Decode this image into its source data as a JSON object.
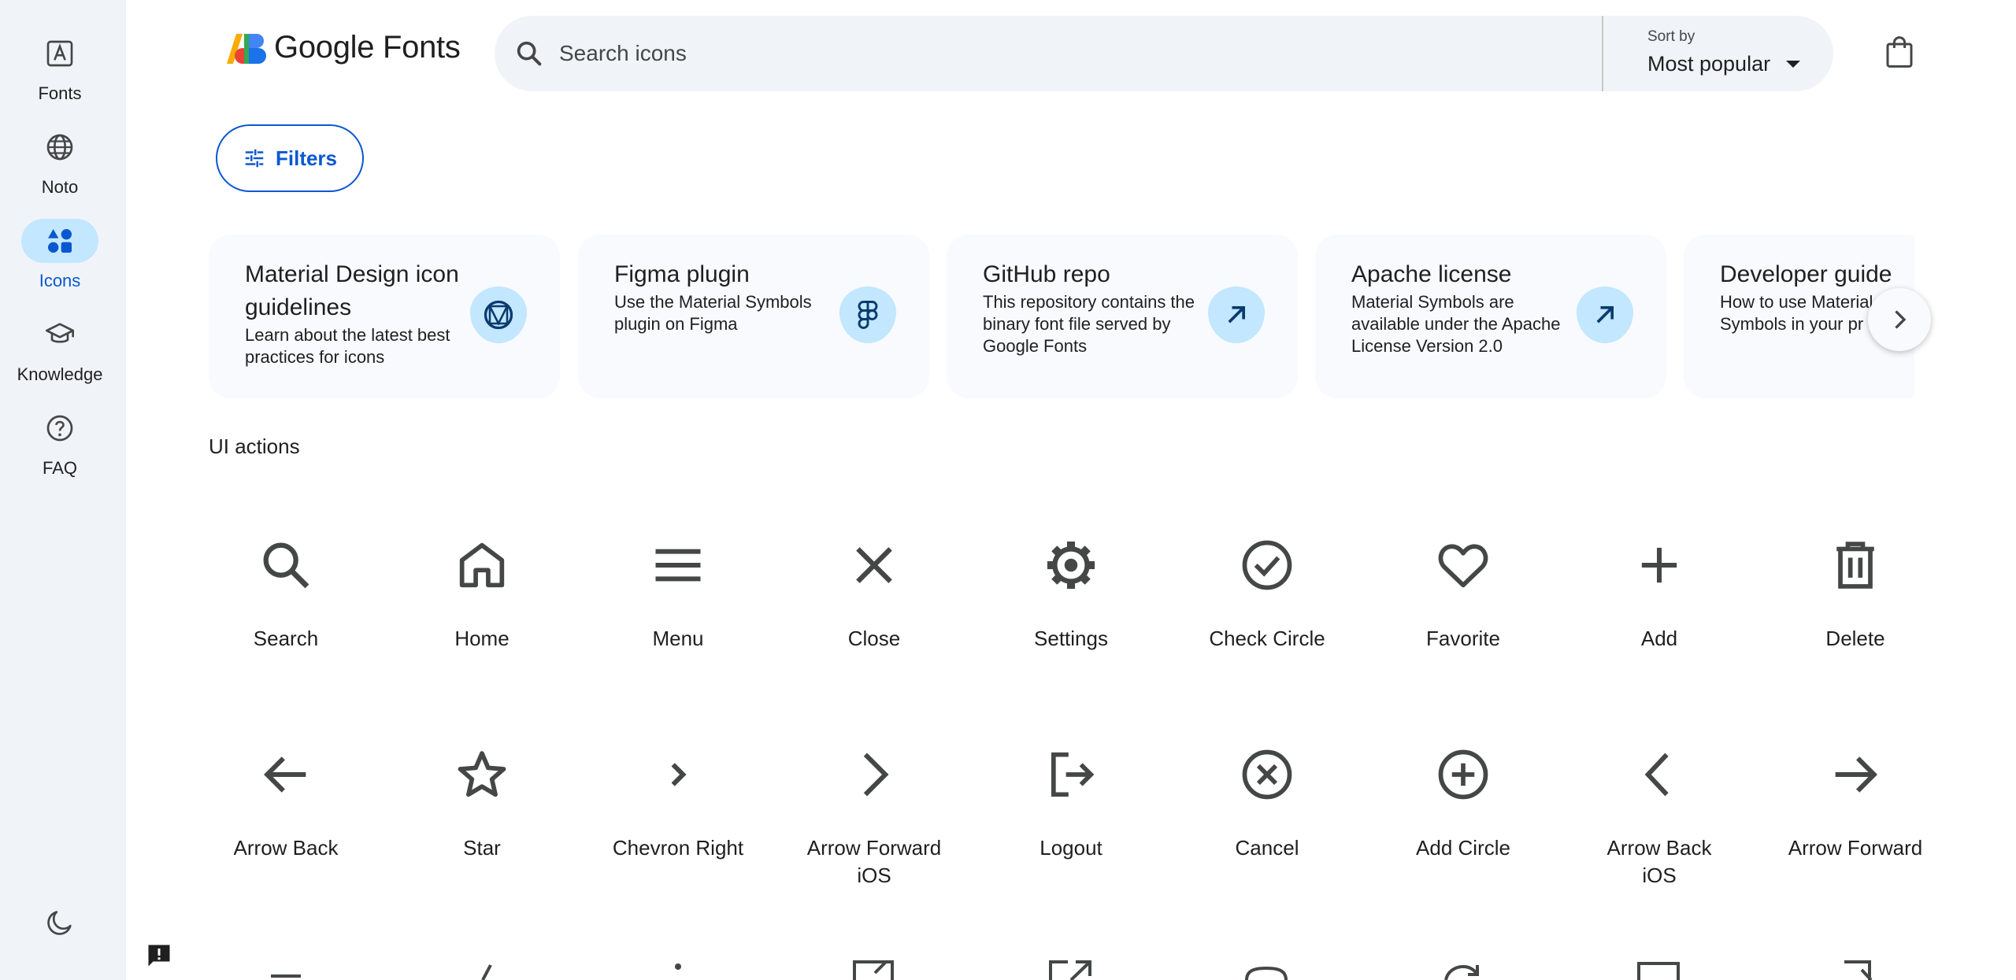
{
  "sidebar": {
    "items": [
      {
        "label": "Fonts",
        "icon": "font-icon"
      },
      {
        "label": "Noto",
        "icon": "globe-icon"
      },
      {
        "label": "Icons",
        "icon": "shapes-icon",
        "active": true
      },
      {
        "label": "Knowledge",
        "icon": "school-icon"
      },
      {
        "label": "FAQ",
        "icon": "help-icon"
      }
    ],
    "dark_mode_icon": "moon-icon"
  },
  "header": {
    "logo_text": "Google Fonts",
    "search_placeholder": "Search icons",
    "sort_caption": "Sort by",
    "sort_value": "Most popular",
    "bag_icon": "shopping-bag-icon"
  },
  "filters": {
    "label": "Filters"
  },
  "cards": [
    {
      "title": "Material Design icon guidelines",
      "desc": "Learn about the latest best practices for icons",
      "icon": "material-logo-icon"
    },
    {
      "title": "Figma plugin",
      "desc": "Use the Material Symbols plugin on Figma",
      "icon": "figma-icon"
    },
    {
      "title": "GitHub repo",
      "desc": "This repository contains the binary font file served by Google Fonts",
      "icon": "arrow-outward-icon"
    },
    {
      "title": "Apache license",
      "desc": "Material Symbols are available under the Apache License Version 2.0",
      "icon": "arrow-outward-icon"
    },
    {
      "title": "Developer guide",
      "desc": "How to use Material Symbols in your pr",
      "icon": "arrow-outward-icon"
    }
  ],
  "section": {
    "title": "UI actions"
  },
  "icons_row1": [
    {
      "label": "Search",
      "icon": "search-icon"
    },
    {
      "label": "Home",
      "icon": "home-icon"
    },
    {
      "label": "Menu",
      "icon": "menu-icon"
    },
    {
      "label": "Close",
      "icon": "close-icon"
    },
    {
      "label": "Settings",
      "icon": "settings-icon"
    },
    {
      "label": "Check Circle",
      "icon": "check-circle-icon"
    },
    {
      "label": "Favorite",
      "icon": "favorite-icon"
    },
    {
      "label": "Add",
      "icon": "add-icon"
    },
    {
      "label": "Delete",
      "icon": "delete-icon"
    }
  ],
  "icons_row2": [
    {
      "label": "Arrow Back",
      "icon": "arrow-back-icon"
    },
    {
      "label": "Star",
      "icon": "star-icon"
    },
    {
      "label": "Chevron Right",
      "icon": "chevron-right-icon"
    },
    {
      "label": "Arrow Forward iOS",
      "icon": "arrow-forward-ios-icon"
    },
    {
      "label": "Logout",
      "icon": "logout-icon"
    },
    {
      "label": "Cancel",
      "icon": "cancel-icon"
    },
    {
      "label": "Add Circle",
      "icon": "add-circle-icon"
    },
    {
      "label": "Arrow Back iOS",
      "icon": "arrow-back-ios-icon"
    },
    {
      "label": "Arrow Forward",
      "icon": "arrow-forward-icon"
    }
  ],
  "colors": {
    "accent": "#0b57d0",
    "sidebar_bg": "#f0f4f9",
    "active_pill": "#c2e7ff",
    "icon_color": "#444746"
  }
}
